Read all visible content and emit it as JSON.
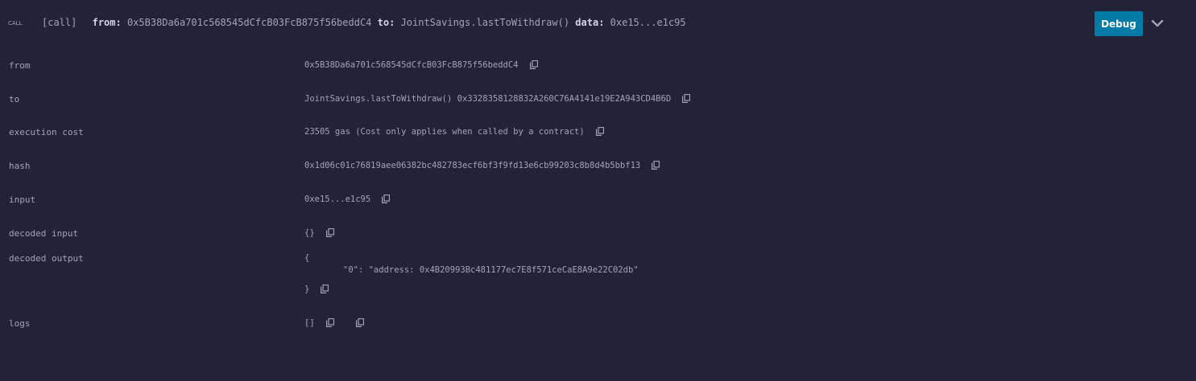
{
  "header": {
    "call_tag": "CALL",
    "call_type": "[call]",
    "from_key": "from:",
    "from_value": "0x5B38Da6a701c568545dCfcB03FcB875f56beddC4",
    "to_key": "to:",
    "to_value": "JointSavings.lastToWithdraw()",
    "data_key": "data:",
    "data_value": "0xe15...e1c95",
    "debug_label": "Debug"
  },
  "details": {
    "from": {
      "label": "from",
      "value": "0x5B38Da6a701c568545dCfcB03FcB875f56beddC4"
    },
    "to": {
      "label": "to",
      "value": "JointSavings.lastToWithdraw() 0x3328358128832A260C76A4141e19E2A943CD4B6D"
    },
    "execution_cost": {
      "label": "execution cost",
      "value": "23505 gas (Cost only applies when called by a contract)"
    },
    "hash": {
      "label": "hash",
      "value": "0x1d06c01c76819aee06382bc482783ecf6bf3f9fd13e6cb99203c8b8d4b5bbf13"
    },
    "input": {
      "label": "input",
      "value": "0xe15...e1c95"
    },
    "decoded_input": {
      "label": "decoded input",
      "value": "{}"
    },
    "decoded_output": {
      "label": "decoded output",
      "open": "{",
      "entry": "\"0\": \"address: 0x4B20993Bc481177ec7E8f571ceCaE8A9e22C02db\"",
      "close": "}"
    },
    "logs": {
      "label": "logs",
      "value": "[]"
    }
  },
  "icons": {
    "copy": "copy-icon",
    "chevron": "chevron-down-icon"
  },
  "colors": {
    "background": "#222336",
    "text": "#a2a3bd",
    "debug_button": "#007aa6"
  }
}
